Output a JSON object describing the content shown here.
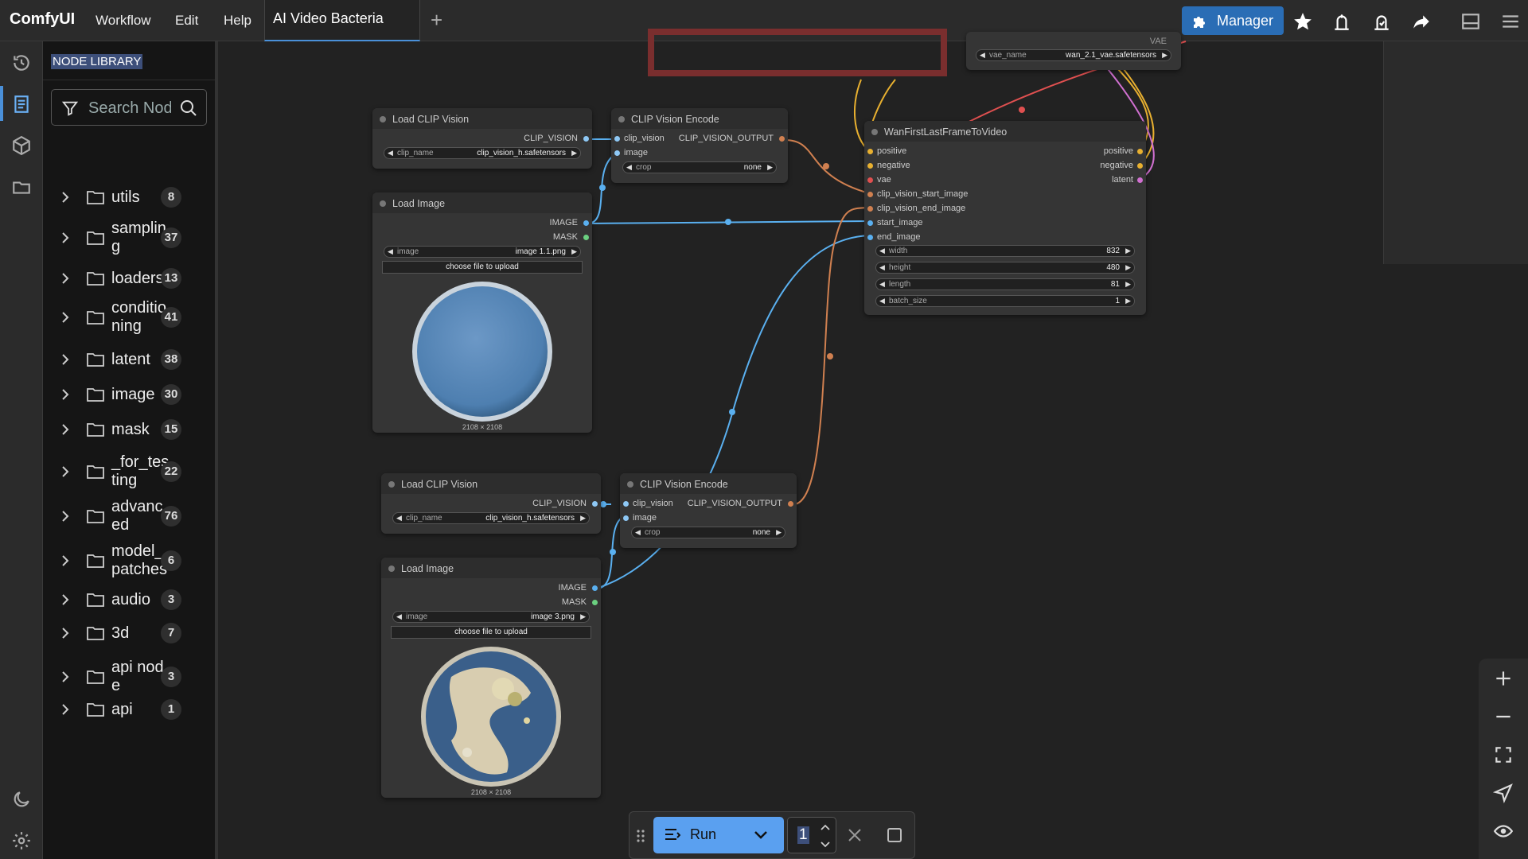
{
  "app": {
    "brand": "ComfyUI"
  },
  "menu": [
    "Workflow",
    "Edit",
    "Help"
  ],
  "tab": {
    "title": "AI Video Bacteria"
  },
  "manager": {
    "label": "Manager"
  },
  "library": {
    "title": "NODE LIBRARY",
    "search_placeholder": "Search Nodes",
    "items": [
      {
        "label": "utils",
        "count": "8"
      },
      {
        "label": "samplin g",
        "count": "37"
      },
      {
        "label": "loaders",
        "count": "13"
      },
      {
        "label": "conditio ning",
        "count": "41"
      },
      {
        "label": "latent",
        "count": "38"
      },
      {
        "label": "image",
        "count": "30"
      },
      {
        "label": "mask",
        "count": "15"
      },
      {
        "label": "_for_tes ting",
        "count": "22"
      },
      {
        "label": "advanc ed",
        "count": "76"
      },
      {
        "label": "model_ patches",
        "count": "6"
      },
      {
        "label": "audio",
        "count": "3"
      },
      {
        "label": "3d",
        "count": "7"
      },
      {
        "label": "api nod e",
        "count": "3"
      },
      {
        "label": "api",
        "count": "1"
      }
    ]
  },
  "nodes": {
    "vae_loader": {
      "label": "vae_name",
      "value": "wan_2.1_vae.safetensors",
      "out": "VAE"
    },
    "clip1": {
      "title": "Load CLIP Vision",
      "out": "CLIP_VISION",
      "w_label": "clip_name",
      "w_value": "clip_vision_h.safetensors"
    },
    "enc1": {
      "title": "CLIP Vision Encode",
      "in1": "clip_vision",
      "in2": "image",
      "out": "CLIP_VISION_OUTPUT",
      "w_label": "crop",
      "w_value": "none"
    },
    "img1": {
      "title": "Load Image",
      "out1": "IMAGE",
      "out2": "MASK",
      "w_label": "image",
      "w_value": "image 1.1.png",
      "upload": "choose file to upload",
      "dims": "2108 × 2108"
    },
    "clip2": {
      "title": "Load CLIP Vision",
      "out": "CLIP_VISION",
      "w_label": "clip_name",
      "w_value": "clip_vision_h.safetensors"
    },
    "enc2": {
      "title": "CLIP Vision Encode",
      "in1": "clip_vision",
      "in2": "image",
      "out": "CLIP_VISION_OUTPUT",
      "w_label": "crop",
      "w_value": "none"
    },
    "img2": {
      "title": "Load Image",
      "out1": "IMAGE",
      "out2": "MASK",
      "w_label": "image",
      "w_value": "image 3.png",
      "upload": "choose file to upload",
      "dims": "2108 × 2108"
    },
    "wan": {
      "title": "WanFirstLastFrameToVideo",
      "inputs": [
        "positive",
        "negative",
        "vae",
        "clip_vision_start_image",
        "clip_vision_end_image",
        "start_image",
        "end_image"
      ],
      "outputs": [
        "positive",
        "negative",
        "latent"
      ],
      "widgets": [
        {
          "label": "width",
          "value": "832"
        },
        {
          "label": "height",
          "value": "480"
        },
        {
          "label": "length",
          "value": "81"
        },
        {
          "label": "batch_size",
          "value": "1"
        }
      ]
    }
  },
  "run": {
    "label": "Run",
    "count": "1"
  },
  "colors": {
    "accent": "#4a90d9",
    "run": "#5aa0f0",
    "manager": "#2a6db5",
    "link_image": "#5ab0f0",
    "link_clip": "#d08050"
  }
}
